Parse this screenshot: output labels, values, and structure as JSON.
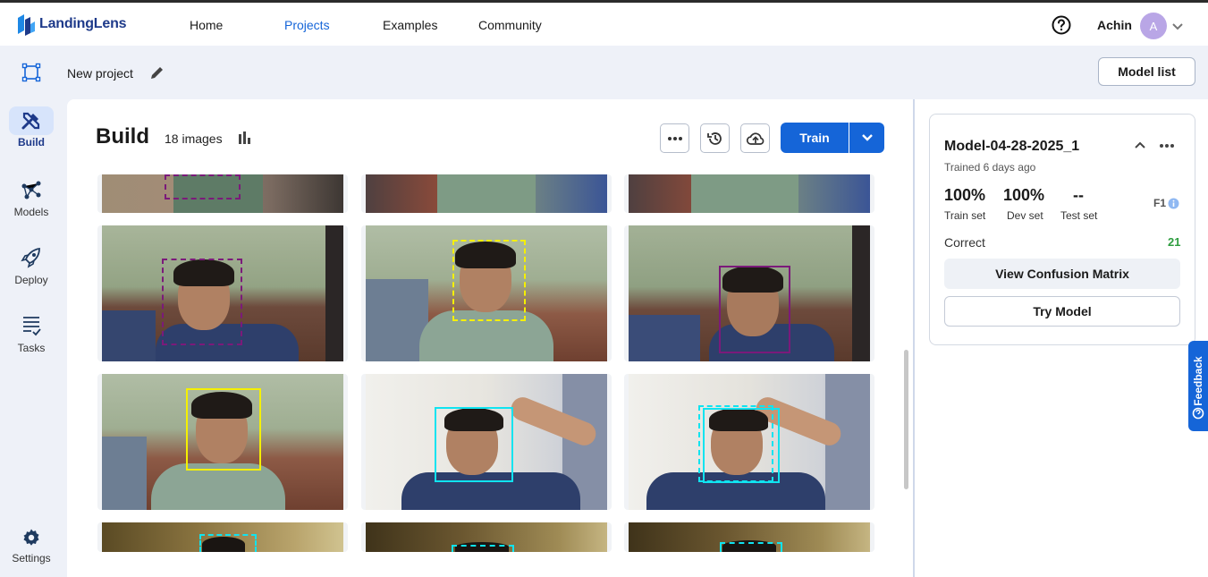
{
  "app": {
    "brand": "LandingLens"
  },
  "nav": {
    "home": "Home",
    "projects": "Projects",
    "examples": "Examples",
    "community": "Community"
  },
  "user": {
    "name": "Achin",
    "initial": "A"
  },
  "sidebar": {
    "build": "Build",
    "models": "Models",
    "deploy": "Deploy",
    "tasks": "Tasks",
    "settings": "Settings"
  },
  "project": {
    "name": "New project",
    "model_list_label": "Model list"
  },
  "build": {
    "title": "Build",
    "image_count": "18 images",
    "train_label": "Train"
  },
  "model": {
    "name": "Model-04-28-2025_1",
    "trained": "Trained 6 days ago",
    "train_set_value": "100%",
    "train_set_label": "Train set",
    "dev_set_value": "100%",
    "dev_set_label": "Dev set",
    "test_set_value": "--",
    "test_set_label": "Test set",
    "metric_label": "F1",
    "correct_label": "Correct",
    "correct_value": "21",
    "confusion_label": "View Confusion Matrix",
    "try_label": "Try Model"
  },
  "feedback": {
    "label": "Feedback"
  },
  "colors": {
    "accent": "#1565d8",
    "box_purple": "#7b1a7a",
    "box_yellow": "#f5f000",
    "box_cyan": "#10e3f0",
    "correct_green": "#2e9d3f"
  }
}
